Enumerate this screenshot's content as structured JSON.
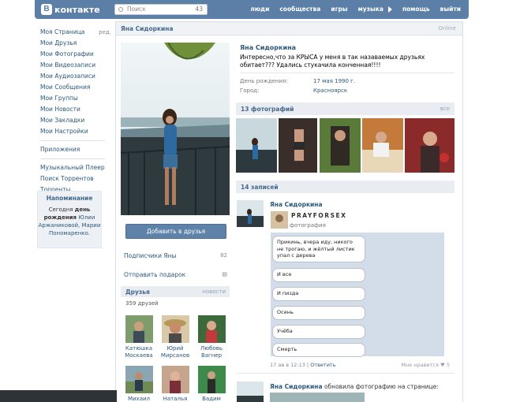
{
  "header": {
    "logo_text": "контакте",
    "logo_letter": "В",
    "search_placeholder": "Поиск",
    "search_count": "43",
    "nav": [
      "люди",
      "сообщества",
      "игры",
      "музыка",
      "помощь",
      "выйти"
    ]
  },
  "left_menu": {
    "edit_label": "ред.",
    "items": [
      "Моя Страница",
      "Мои Друзья",
      "Мои Фотографии",
      "Мои Видеозаписи",
      "Мои Аудиозаписи",
      "Мои Сообщения",
      "Мои Группы",
      "Мои Новости",
      "Мои Закладки",
      "Мои Настройки"
    ],
    "apps": "Приложения",
    "extra": [
      "Музыкальный Плеер",
      "Поиск Торрентов",
      "Торренты"
    ]
  },
  "reminder": {
    "title": "Напоминание",
    "line1": "Сегодня",
    "bold1": "день",
    "bold2": "рождения",
    "who": "Юлии Аржаниковой, Марии Пономаренко."
  },
  "profile": {
    "top_name": "Яна Сидоркина",
    "online": "Online",
    "name": "Яна Сидоркина",
    "status": "Интересно,что за КРЫСА у меня в так назаваемых друзьях обитает??? Удались стукачила конченная!!!!",
    "birthday_label": "День рождения:",
    "birthday_value": "17 мая 1990 г.",
    "city_label": "Город:",
    "city_value": "Красноярск",
    "add_friend": "Добавить в друзья",
    "subscribers_label": "Подписчики Яны",
    "subscribers_count": "82",
    "gift_label": "Отправить подарок"
  },
  "friends": {
    "title": "Друзья",
    "news_link": "новости",
    "count": "359 друзей",
    "list": [
      {
        "first": "Катюшка",
        "last": "Москаева"
      },
      {
        "first": "Юрий",
        "last": "Мирсанов"
      },
      {
        "first": "Любовь",
        "last": "Вагнер"
      },
      {
        "first": "Михаил",
        "last": ""
      },
      {
        "first": "Наталья",
        "last": ""
      },
      {
        "first": "Вадим",
        "last": ""
      }
    ]
  },
  "photos": {
    "title": "13 фотографий",
    "all_link": "все"
  },
  "wall": {
    "title": "14 записей",
    "post": {
      "author": "Яна Сидоркина",
      "repost_title": "PRAYFORSEX",
      "repost_sub": "фотография",
      "bubbles": [
        "Прикинь, вчера иду, никого не трогаю, и жёлтый листик упал с дерева",
        "И все",
        "И пизда",
        "Осень",
        "Учёба",
        "Смерть"
      ],
      "date": "17 ав в 12:13",
      "reply": "Ответить",
      "likes_label": "Мне нравится",
      "likes_count": "5"
    },
    "post2": {
      "author": "Яна Сидоркина",
      "text": "обновила фотографию на странице:"
    }
  },
  "colors": {
    "header_bg": "#5b7fa6",
    "link": "#2b587a",
    "section_bg": "#e9edf1"
  }
}
